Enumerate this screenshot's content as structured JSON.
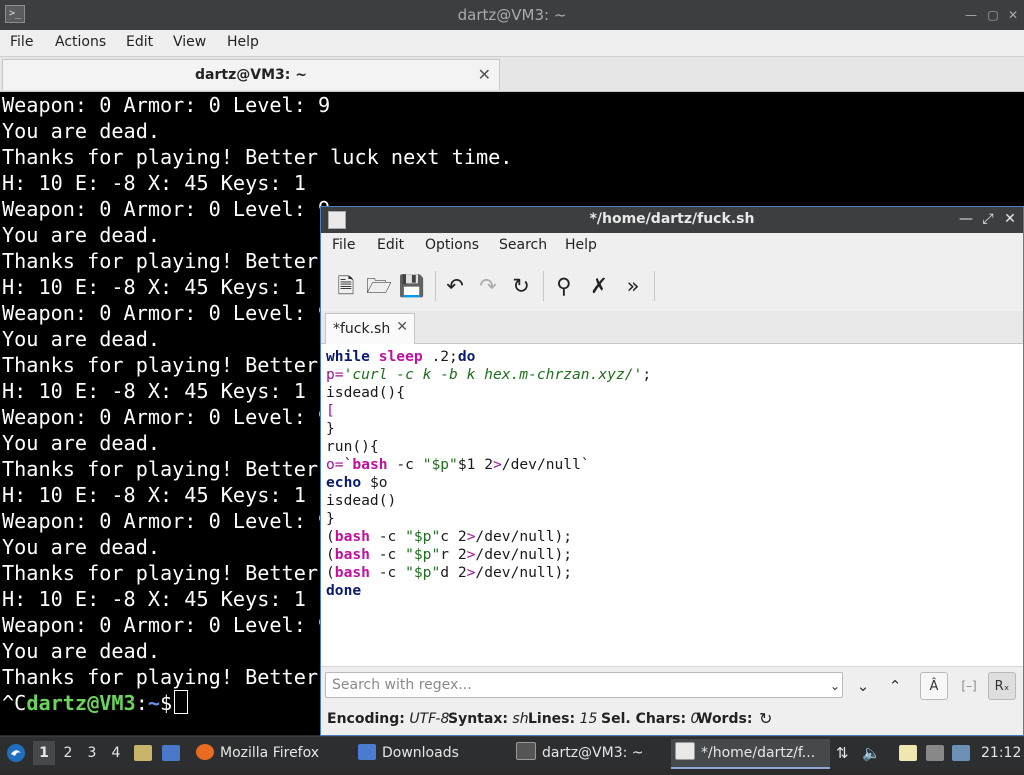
{
  "terminal": {
    "title": "dartz@VM3: ~",
    "menu": [
      "File",
      "Actions",
      "Edit",
      "View",
      "Help"
    ],
    "tab_label": "dartz@VM3: ~",
    "lines": [
      "Weapon: 0 Armor: 0 Level: 9",
      "You are dead.",
      "Thanks for playing! Better luck next time.",
      "H: 10 E: -8 X: 45 Keys: 1",
      "Weapon: 0 Armor: 0 Level: 9",
      "You are dead.",
      "Thanks for playing! Better luck next time.",
      "H: 10 E: -8 X: 45 Keys: 1",
      "Weapon: 0 Armor: 0 Level: 9",
      "You are dead.",
      "Thanks for playing! Better luck next time.",
      "H: 10 E: -8 X: 45 Keys: 1",
      "Weapon: 0 Armor: 0 Level: 9",
      "You are dead.",
      "Thanks for playing! Better luck next time.",
      "H: 10 E: -8 X: 45 Keys: 1",
      "Weapon: 0 Armor: 0 Level: 9",
      "You are dead.",
      "Thanks for playing! Better luck next time.",
      "H: 10 E: -8 X: 45 Keys: 1",
      "Weapon: 0 Armor: 0 Level: 9",
      "You are dead.",
      "Thanks for playing! Better luck next time."
    ],
    "prompt": {
      "interrupt": "^C",
      "user_host": "dartz@VM3",
      "sep": ":",
      "path": "~",
      "symbol": "$"
    }
  },
  "editor": {
    "title": "*/home/dartz/fuck.sh",
    "menu": [
      "File",
      "Edit",
      "Options",
      "Search",
      "Help"
    ],
    "toolbar": [
      "new-file-icon",
      "open-file-icon",
      "save-icon",
      "undo-icon",
      "redo-icon",
      "reload-icon",
      "find-icon",
      "replace-icon",
      "more-icon"
    ],
    "tab_label": "*fuck.sh",
    "search_placeholder": "Search with regex...",
    "status": {
      "encoding_label": "Encoding:",
      "encoding": "UTF-8",
      "syntax_label": "Syntax:",
      "syntax": "sh",
      "lines_label": "Lines:",
      "lines": "15",
      "selchars_label": "Sel. Chars:",
      "selchars": "0",
      "words_label": "Words:"
    },
    "code": [
      [
        {
          "t": "while",
          "c": "kw"
        },
        {
          "t": " "
        },
        {
          "t": "sleep",
          "c": "bi"
        },
        {
          "t": " .2;"
        },
        {
          "t": "do",
          "c": "kw"
        }
      ],
      [
        {
          "t": "p=",
          "c": "var"
        },
        {
          "t": "'curl -c k -b k hex.m-chrzan.xyz/'",
          "c": "str it"
        },
        {
          "t": ";"
        }
      ],
      [
        {
          "t": "isdead(){"
        }
      ],
      [
        {
          "t": "[",
          "c": "var"
        }
      ],
      [
        {
          "t": "}"
        }
      ],
      [
        {
          "t": "run(){"
        }
      ],
      [
        {
          "t": "o=",
          "c": "var"
        },
        {
          "t": "`"
        },
        {
          "t": "bash",
          "c": "bi"
        },
        {
          "t": " -c "
        },
        {
          "t": "\"$p\"",
          "c": "str"
        },
        {
          "t": "$1 2"
        },
        {
          "t": ">",
          "c": "var"
        },
        {
          "t": "/dev/null`"
        }
      ],
      [
        {
          "t": "echo",
          "c": "kw"
        },
        {
          "t": " $o"
        }
      ],
      [
        {
          "t": "isdead()"
        }
      ],
      [
        {
          "t": "}"
        }
      ],
      [
        {
          "t": "("
        },
        {
          "t": "bash",
          "c": "bi"
        },
        {
          "t": " -c "
        },
        {
          "t": "\"$p\"",
          "c": "str"
        },
        {
          "t": "c 2"
        },
        {
          "t": ">",
          "c": "var"
        },
        {
          "t": "/dev/null);"
        }
      ],
      [
        {
          "t": "("
        },
        {
          "t": "bash",
          "c": "bi"
        },
        {
          "t": " -c "
        },
        {
          "t": "\"$p\"",
          "c": "str"
        },
        {
          "t": "r 2"
        },
        {
          "t": ">",
          "c": "var"
        },
        {
          "t": "/dev/null);"
        }
      ],
      [
        {
          "t": "("
        },
        {
          "t": "bash",
          "c": "bi"
        },
        {
          "t": " -c "
        },
        {
          "t": "\"$p\"",
          "c": "str"
        },
        {
          "t": "d 2"
        },
        {
          "t": ">",
          "c": "var"
        },
        {
          "t": "/dev/null);"
        }
      ],
      [
        {
          "t": "done",
          "c": "kw"
        }
      ]
    ]
  },
  "taskbar": {
    "workspaces": [
      "1",
      "2",
      "3",
      "4"
    ],
    "tasks": [
      {
        "icon": "firefox-icon",
        "label": "Mozilla Firefox"
      },
      {
        "icon": "folder-icon",
        "label": "Downloads"
      },
      {
        "icon": "terminal-icon",
        "label": "dartz@VM3: ~"
      },
      {
        "icon": "text-editor-icon",
        "label": "*/home/dartz/f..."
      }
    ],
    "clock": "21:12"
  }
}
